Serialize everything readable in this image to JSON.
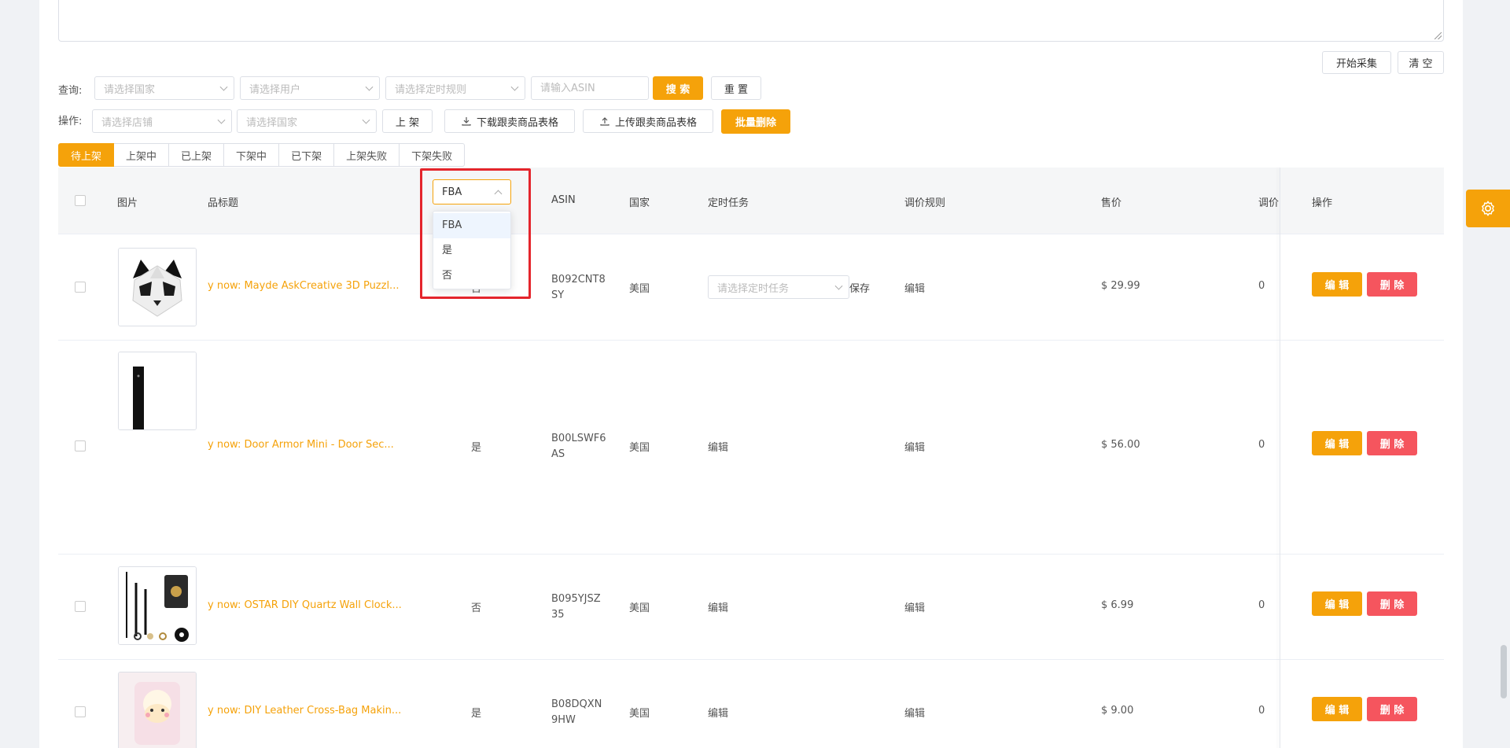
{
  "actions": {
    "start_collect": "开始采集",
    "clear": "清 空"
  },
  "query": {
    "label": "查询:",
    "country_placeholder": "请选择国家",
    "user_placeholder": "请选择用户",
    "rule_placeholder": "请选择定时规则",
    "asin_placeholder": "请输入ASIN",
    "search": "搜 索",
    "reset": "重 置"
  },
  "operation": {
    "label": "操作:",
    "shop_placeholder": "请选择店铺",
    "country_placeholder": "请选择国家",
    "list_btn": "上 架",
    "download_btn": "下载跟卖商品表格",
    "upload_btn": "上传跟卖商品表格",
    "bulk_delete": "批量删除"
  },
  "tabs": [
    "待上架",
    "上架中",
    "已上架",
    "下架中",
    "已下架",
    "上架失败",
    "下架失败"
  ],
  "columns": {
    "image": "图片",
    "title": "品标题",
    "asin": "ASIN",
    "country": "国家",
    "schedule": "定时任务",
    "pricing_rule": "调价规则",
    "price": "售价",
    "adjust": "调价",
    "ops": "操作"
  },
  "fba_dropdown": {
    "value": "FBA",
    "options": [
      "FBA",
      "是",
      "否"
    ]
  },
  "rows": [
    {
      "title": "y now: Mayde AskCreative 3D Puzzl...",
      "fba": "否",
      "asin": "B092CNT8SY",
      "country": "美国",
      "schedule_placeholder": "请选择定时任务",
      "save": "保存",
      "rule": "编辑",
      "price": "$ 29.99",
      "adjust": "0",
      "edit": "编 辑",
      "delete": "删 除"
    },
    {
      "title": "y now: Door Armor Mini - Door Sec...",
      "fba": "是",
      "asin": "B00LSWF6AS",
      "country": "美国",
      "schedule": "编辑",
      "rule": "编辑",
      "price": "$ 56.00",
      "adjust": "0",
      "edit": "编 辑",
      "delete": "删 除"
    },
    {
      "title": "y now: OSTAR DIY Quartz Wall Clock...",
      "fba": "否",
      "asin": "B095YJSZ35",
      "country": "美国",
      "schedule": "编辑",
      "rule": "编辑",
      "price": "$ 6.99",
      "adjust": "0",
      "edit": "编 辑",
      "delete": "删 除"
    },
    {
      "title": "y now: DIY Leather Cross-Bag Makin...",
      "fba": "是",
      "asin": "B08DQXN9HW",
      "country": "美国",
      "schedule": "编辑",
      "rule": "编辑",
      "price": "$ 9.00",
      "adjust": "0",
      "edit": "编 辑",
      "delete": "删 除"
    }
  ],
  "colors": {
    "primary": "#f5a20a",
    "danger": "#f5555e",
    "highlight_box": "#e4252c"
  }
}
